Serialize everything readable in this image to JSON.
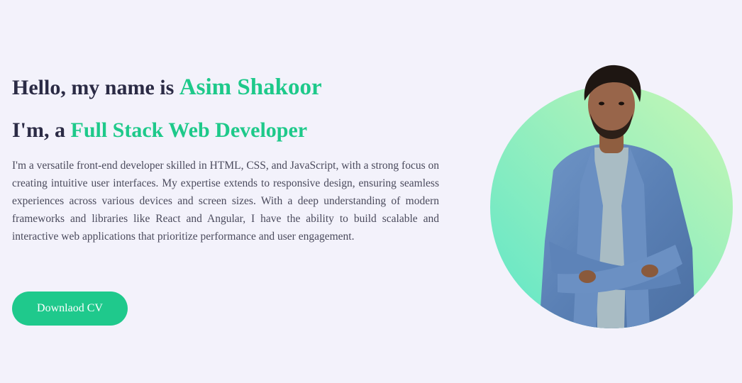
{
  "hero": {
    "greeting_prefix": "Hello, my name is ",
    "name": "Asim Shakoor",
    "role_prefix": "I'm, a ",
    "role": "Full Stack Web Developer",
    "bio": "I'm a versatile front-end developer skilled in HTML, CSS, and JavaScript, with a strong focus on creating intuitive user interfaces. My expertise extends to responsive design, ensuring seamless experiences across various devices and screen sizes. With a deep understanding of modern frameworks and libraries like React and Angular, I have the ability to build scalable and interactive web applications that prioritize performance and user engagement.",
    "cv_button_label": "Downlaod CV"
  },
  "colors": {
    "background": "#f3f2fb",
    "accent": "#1ec98a",
    "heading": "#2b2b45",
    "body_text": "#4a4a5c",
    "circle_gradient_start": "#5fe6c8",
    "circle_gradient_end": "#c9f7b4"
  },
  "portrait": {
    "icon": "person-photo-icon"
  }
}
